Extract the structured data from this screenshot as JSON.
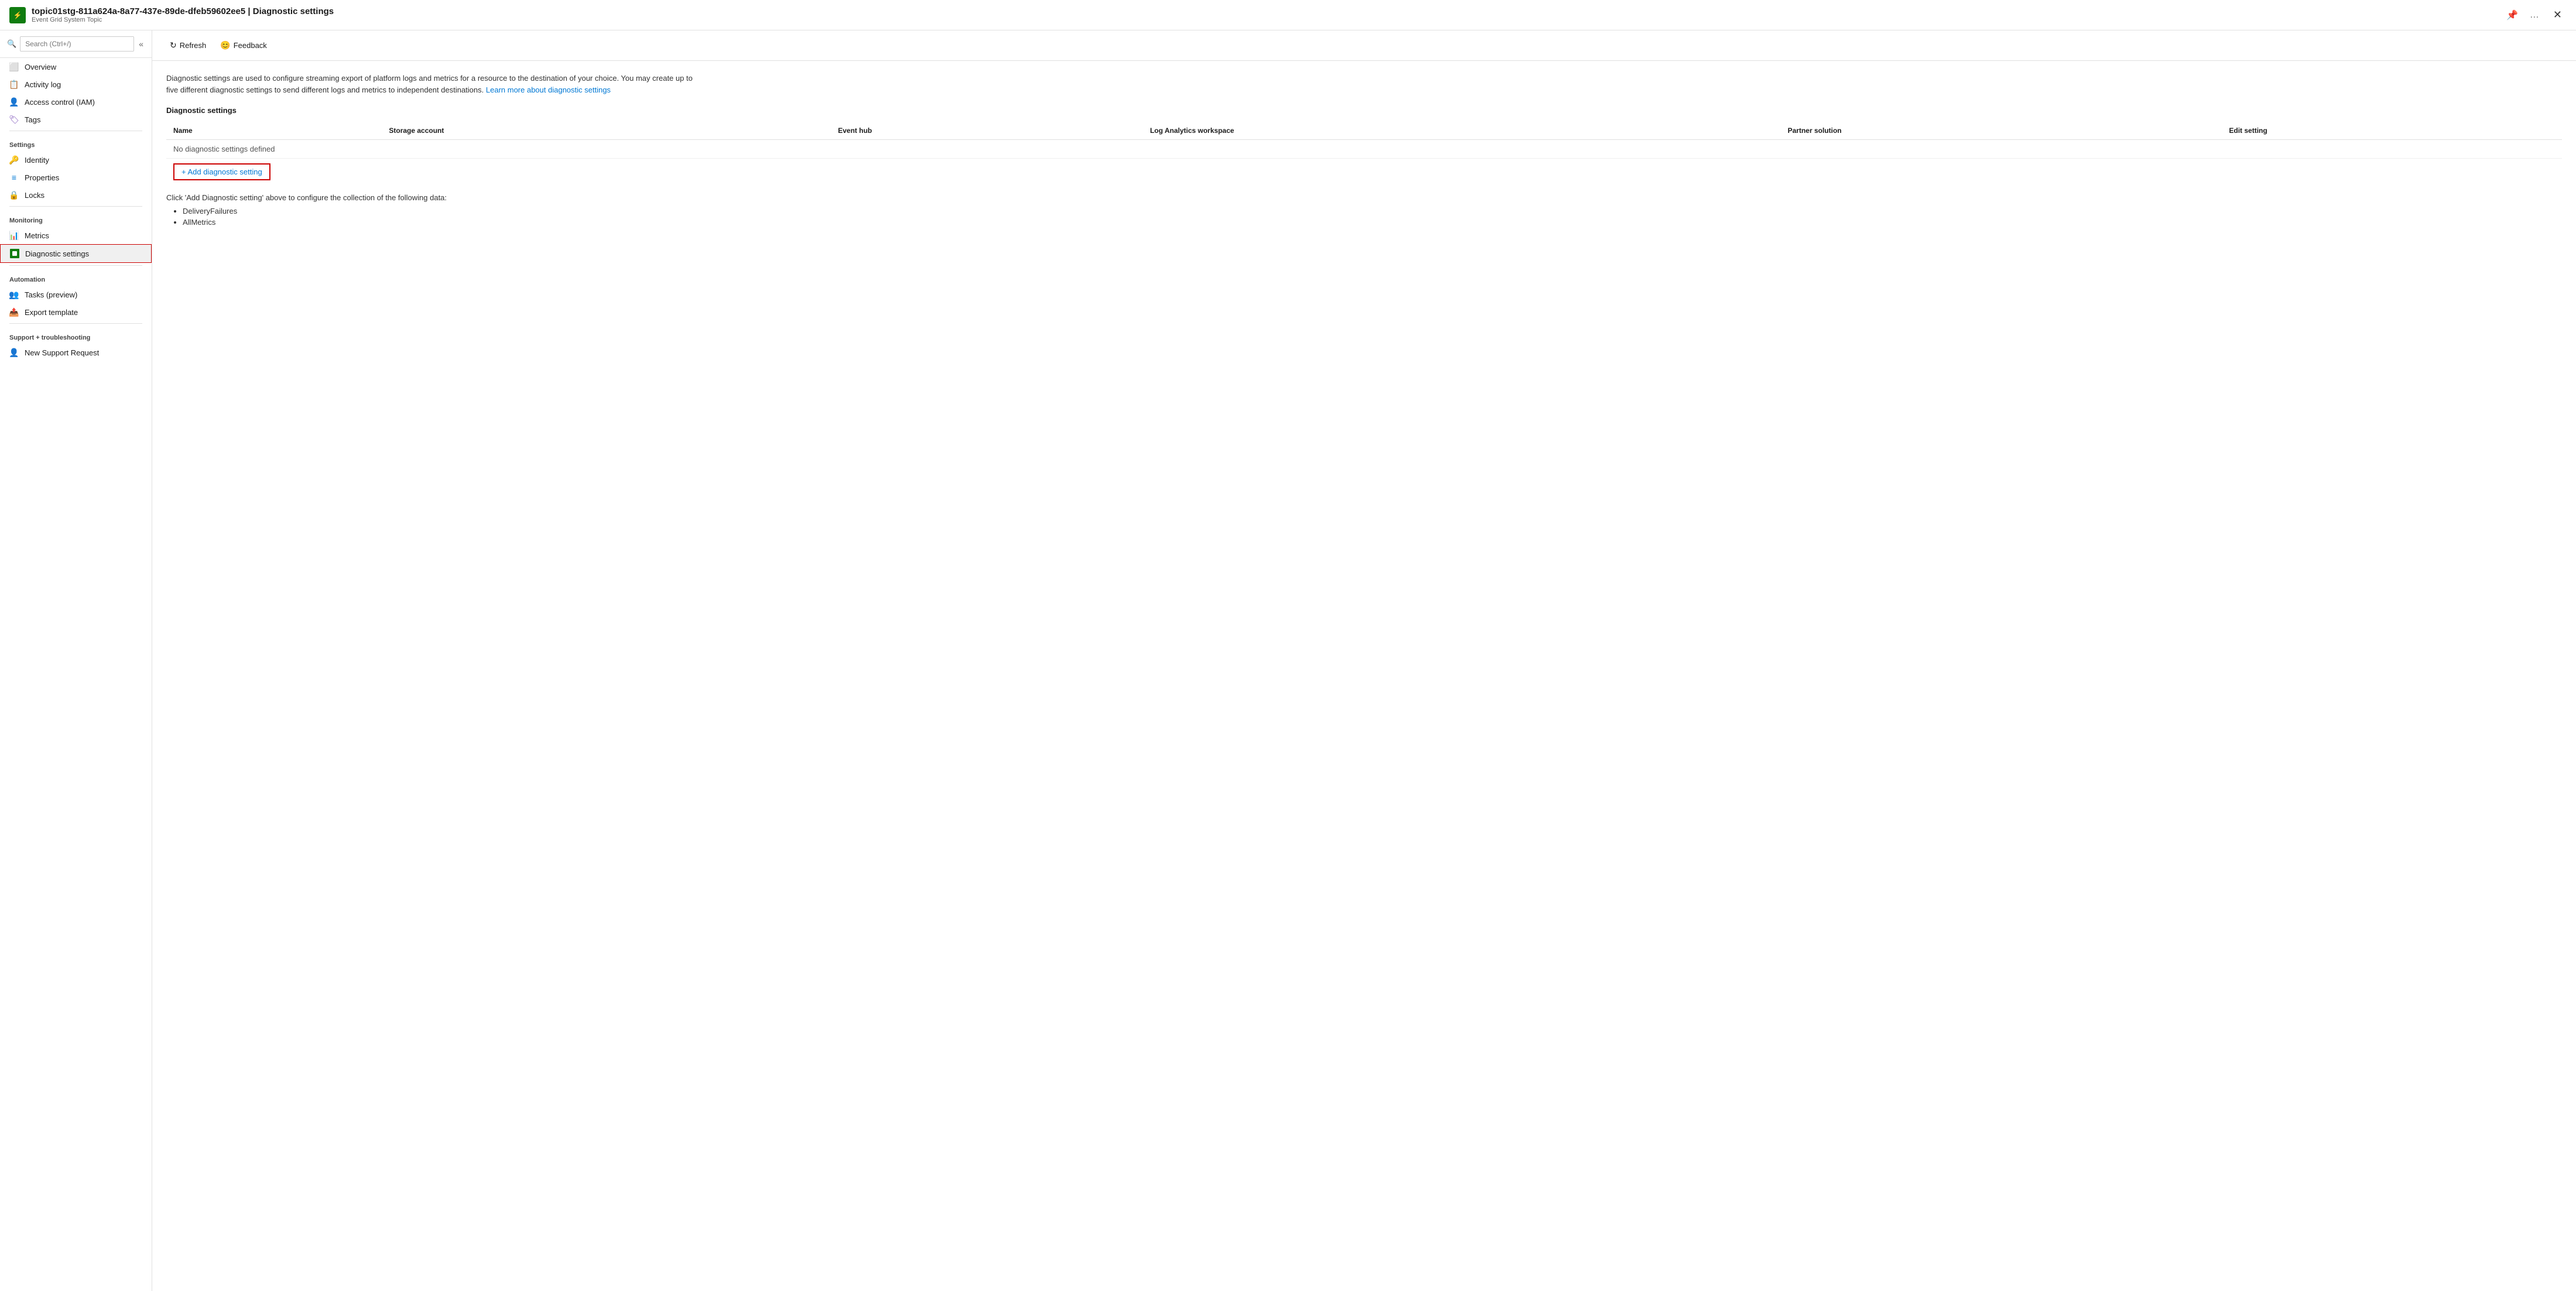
{
  "titleBar": {
    "icon": "⬛",
    "title": "topic01stg-811a624a-8a77-437e-89de-dfeb59602ee5 | Diagnostic settings",
    "subtitle": "Event Grid System Topic",
    "pinIcon": "📌",
    "moreIcon": "…",
    "closeIcon": "✕"
  },
  "sidebar": {
    "search": {
      "placeholder": "Search (Ctrl+/)"
    },
    "collapseIcon": "«",
    "items": [
      {
        "id": "overview",
        "label": "Overview",
        "icon": "overview",
        "section": null
      },
      {
        "id": "activity-log",
        "label": "Activity log",
        "icon": "activity",
        "section": null
      },
      {
        "id": "iam",
        "label": "Access control (IAM)",
        "icon": "iam",
        "section": null
      },
      {
        "id": "tags",
        "label": "Tags",
        "icon": "tags",
        "section": null
      },
      {
        "id": "settings",
        "label": "Settings",
        "section": "Settings"
      },
      {
        "id": "identity",
        "label": "Identity",
        "icon": "identity",
        "section": null
      },
      {
        "id": "properties",
        "label": "Properties",
        "icon": "properties",
        "section": null
      },
      {
        "id": "locks",
        "label": "Locks",
        "icon": "locks",
        "section": null
      },
      {
        "id": "monitoring",
        "label": "Monitoring",
        "section": "Monitoring"
      },
      {
        "id": "metrics",
        "label": "Metrics",
        "icon": "metrics",
        "section": null
      },
      {
        "id": "diagnostic-settings",
        "label": "Diagnostic settings",
        "icon": "diagnostic",
        "section": null,
        "active": true
      },
      {
        "id": "automation",
        "label": "Automation",
        "section": "Automation"
      },
      {
        "id": "tasks",
        "label": "Tasks (preview)",
        "icon": "tasks",
        "section": null
      },
      {
        "id": "export-template",
        "label": "Export template",
        "icon": "export",
        "section": null
      },
      {
        "id": "support-troubleshooting",
        "label": "Support + troubleshooting",
        "section": "Support + troubleshooting"
      },
      {
        "id": "new-support",
        "label": "New Support Request",
        "icon": "support",
        "section": null
      }
    ]
  },
  "toolbar": {
    "refreshLabel": "Refresh",
    "feedbackLabel": "Feedback"
  },
  "content": {
    "descriptionText": "Diagnostic settings are used to configure streaming export of platform logs and metrics for a resource to the destination of your choice. You may create up to five different diagnostic settings to send different logs and metrics to independent destinations.",
    "learnMoreText": "Learn more about diagnostic settings",
    "learnMoreUrl": "#",
    "sectionTitle": "Diagnostic settings",
    "tableHeaders": [
      "Name",
      "Storage account",
      "Event hub",
      "Log Analytics workspace",
      "Partner solution",
      "Edit setting"
    ],
    "noSettingsText": "No diagnostic settings defined",
    "addButtonLabel": "+ Add diagnostic setting",
    "configureText": "Click 'Add Diagnostic setting' above to configure the collection of the following data:",
    "dataItems": [
      "DeliveryFailures",
      "AllMetrics"
    ]
  }
}
